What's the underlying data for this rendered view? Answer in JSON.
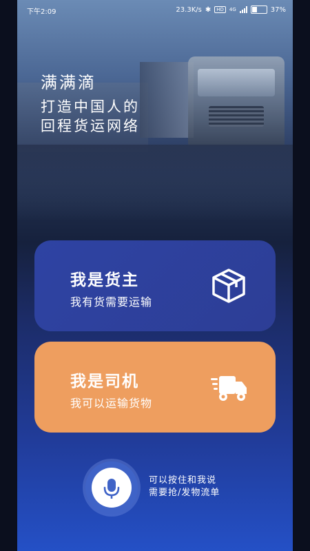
{
  "status_bar": {
    "time": "下午2:09",
    "network_speed": "23.3K/s",
    "battery": "37%",
    "hd_label": "HD",
    "signal_label": "4G"
  },
  "hero": {
    "brand": "满满滴",
    "slogan_line1": "打造中国人的",
    "slogan_line2": "回程货运网络"
  },
  "cards": {
    "owner": {
      "title": "我是货主",
      "subtitle": "我有货需要运输",
      "icon": "package-box-icon"
    },
    "driver": {
      "title": "我是司机",
      "subtitle": "我可以运输货物",
      "icon": "delivery-truck-icon"
    }
  },
  "voice": {
    "icon": "microphone-icon",
    "tip_line1": "可以按住和我说",
    "tip_line2": "需要抢/发物流单"
  },
  "colors": {
    "owner_card": "#2e43a3",
    "driver_card": "#ee9e5f",
    "mic_blue": "#3f63c7"
  }
}
